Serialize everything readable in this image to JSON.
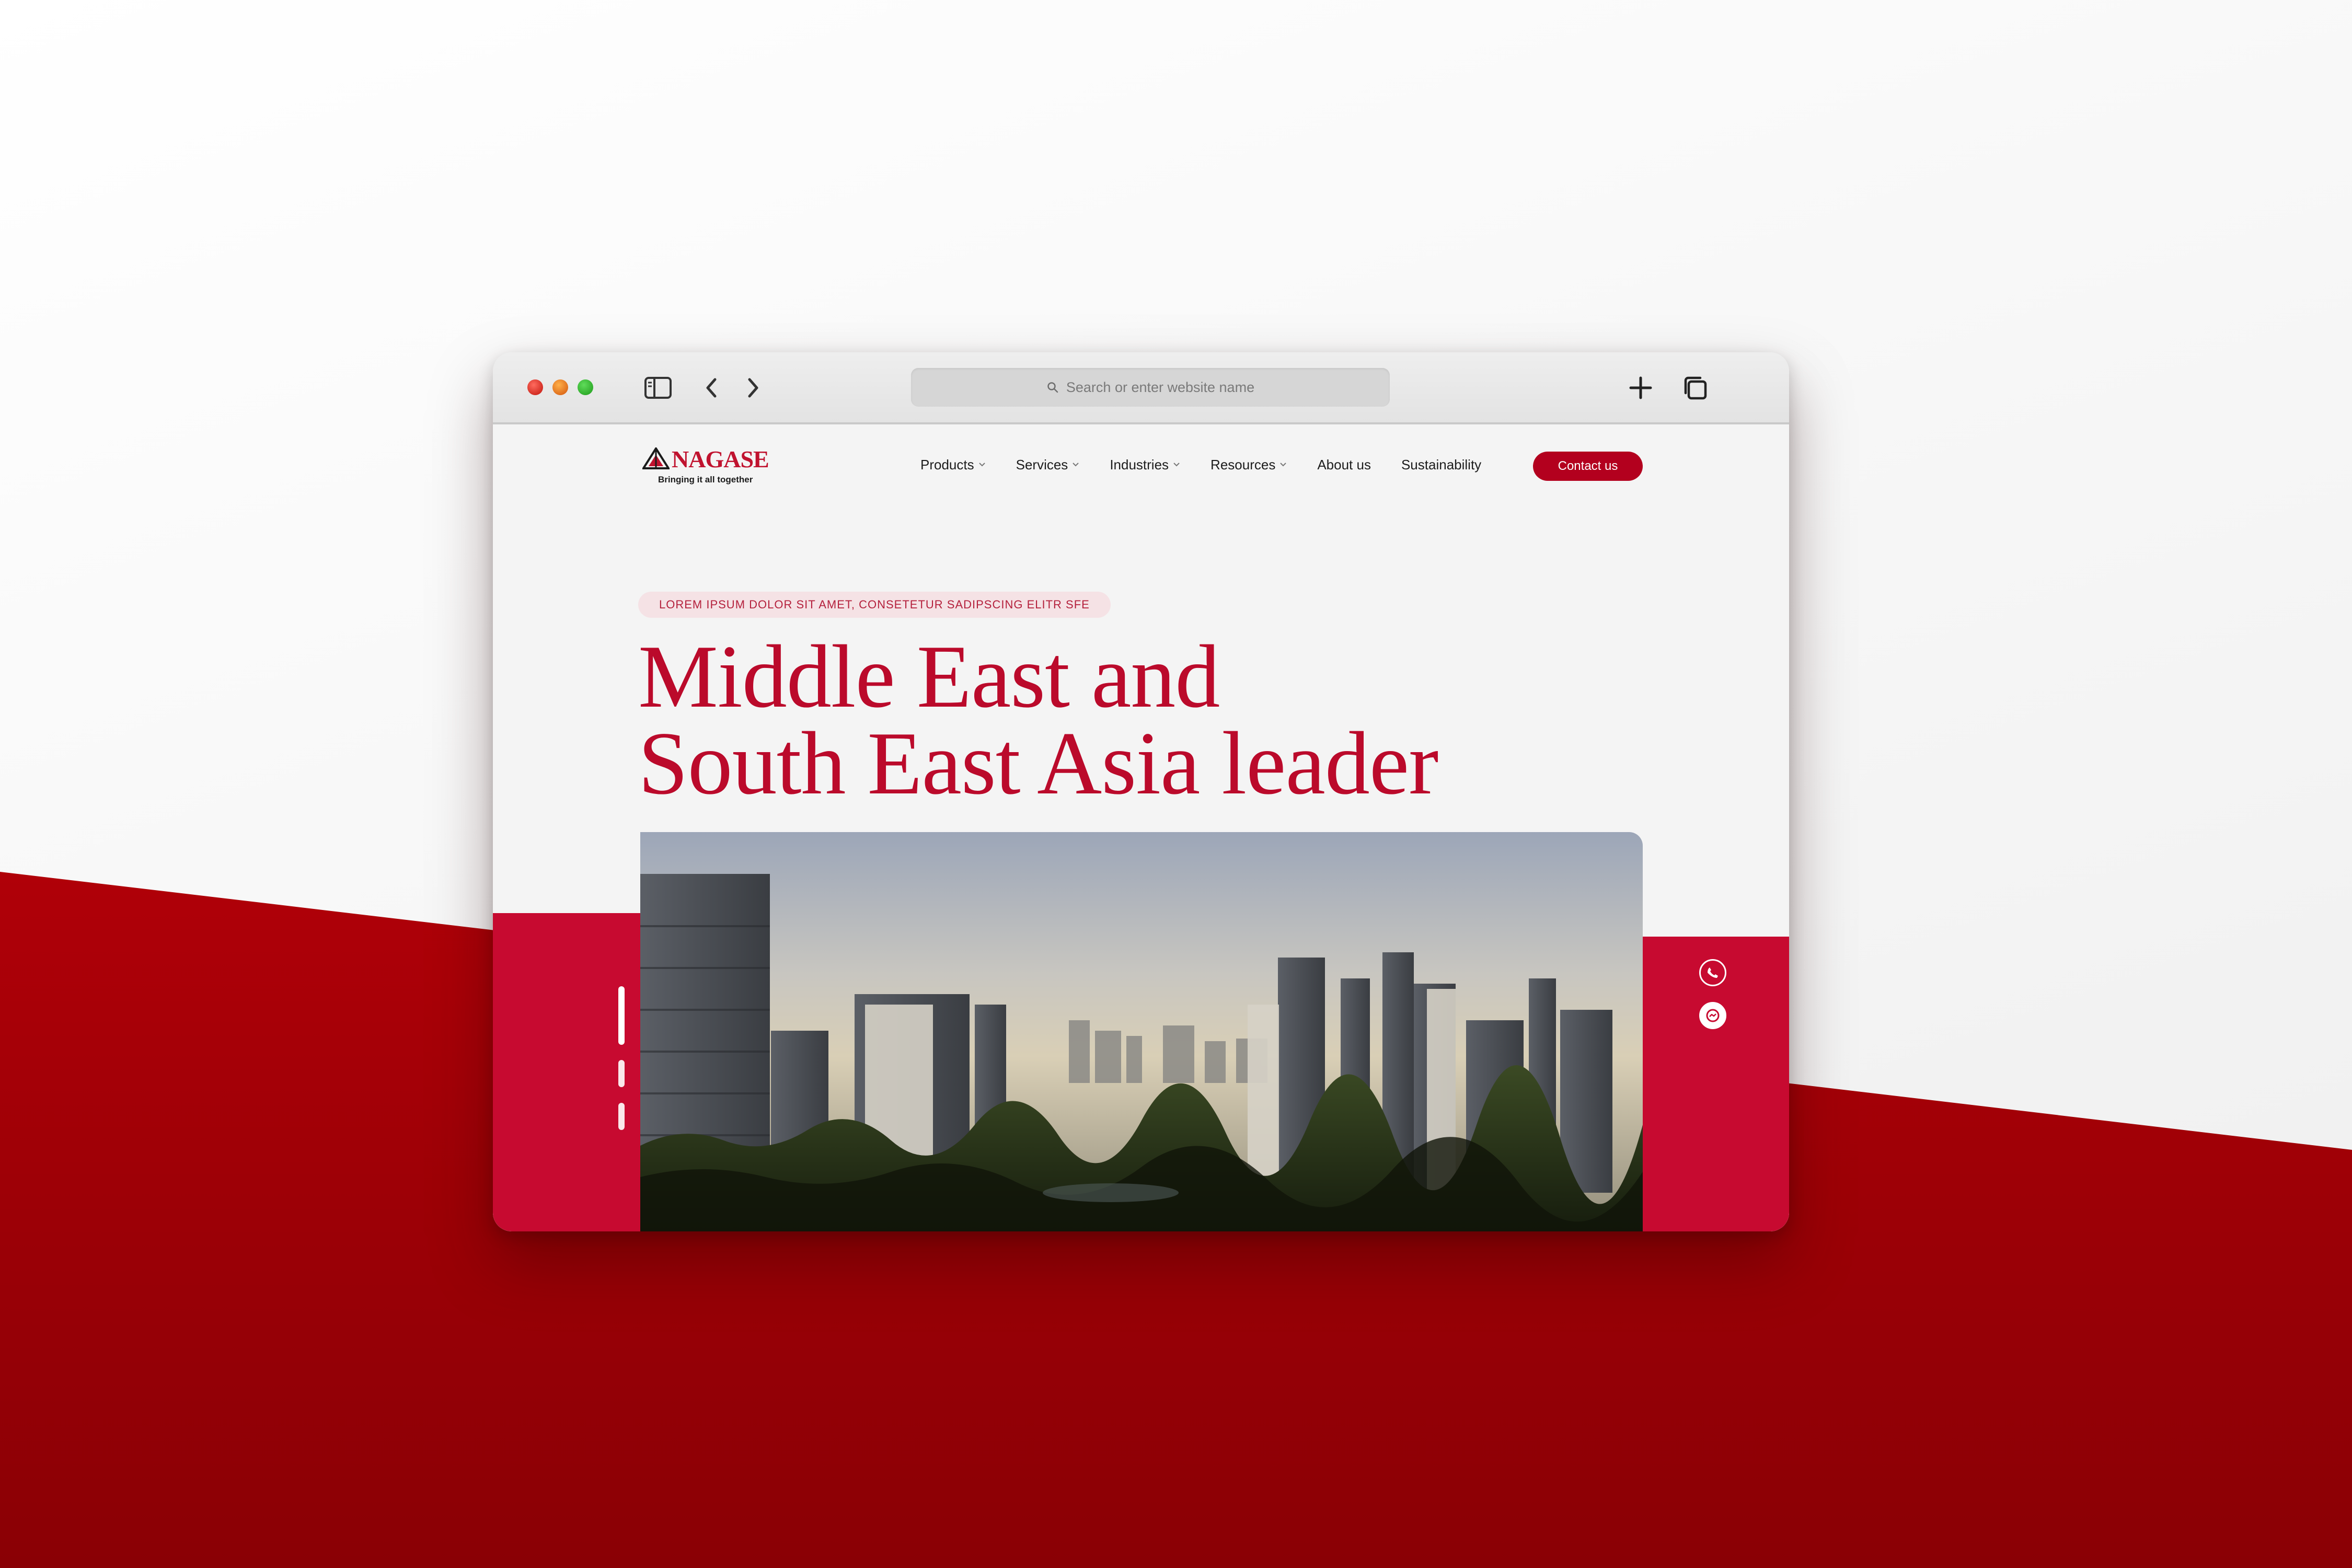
{
  "scene": {
    "colors": {
      "brand_red": "#c70a30",
      "backdrop_red": "#a30007",
      "title_red": "#bb0a2b",
      "button_red": "#b3001e"
    }
  },
  "browser": {
    "traffic_lights": [
      "close",
      "minimize",
      "zoom"
    ],
    "sidebar_icon": "sidebar-icon",
    "back_icon": "chevron-left-icon",
    "forward_icon": "chevron-right-icon",
    "address_bar": {
      "placeholder": "Search or enter website name",
      "icon": "search-icon"
    },
    "new_tab_icon": "plus-icon",
    "tabs_icon": "tabs-overview-icon"
  },
  "site": {
    "logo": {
      "name": "NAGASE",
      "tagline": "Bringing it all together"
    },
    "nav": [
      {
        "label": "Products",
        "has_dropdown": true
      },
      {
        "label": "Services",
        "has_dropdown": true
      },
      {
        "label": "Industries",
        "has_dropdown": true
      },
      {
        "label": "Resources",
        "has_dropdown": true
      },
      {
        "label": "About us",
        "has_dropdown": false
      },
      {
        "label": "Sustainability",
        "has_dropdown": false
      }
    ],
    "contact_button": "Contact us",
    "hero": {
      "eyebrow": "LOREM IPSUM DOLOR SIT AMET, CONSETETUR  SADIPSCING ELITR SFE",
      "title_line1": "Middle East and",
      "title_line2": "South East Asia leader",
      "image_subject": "city-skyline-photo",
      "slides_total": 3,
      "slide_active": 1
    },
    "side_actions": [
      "phone-icon",
      "messenger-icon"
    ]
  }
}
